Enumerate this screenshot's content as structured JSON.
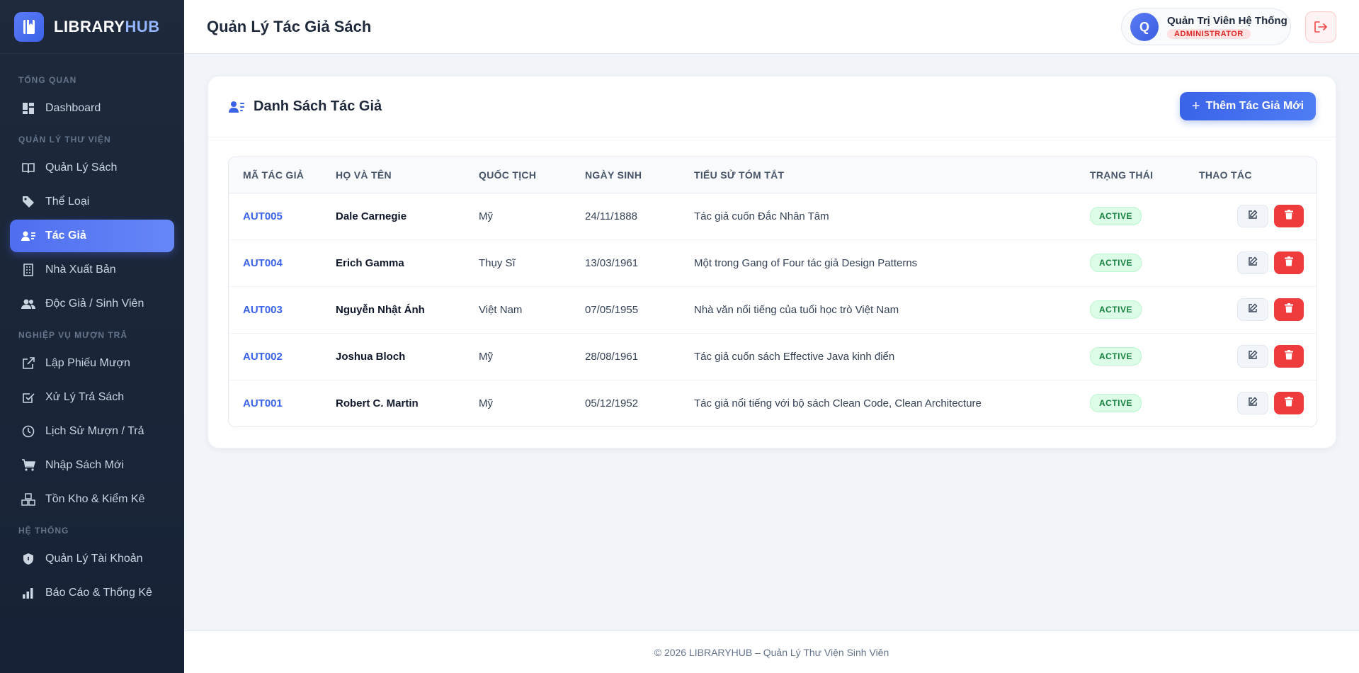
{
  "brand": {
    "prefix": "LIBRARY",
    "suffix": "HUB"
  },
  "sidebar": {
    "sections": [
      {
        "title": "TỔNG QUAN",
        "items": [
          {
            "label": "Dashboard",
            "icon": "dashboard-icon"
          }
        ]
      },
      {
        "title": "QUẢN LÝ THƯ VIỆN",
        "items": [
          {
            "label": "Quản Lý Sách",
            "icon": "book-icon"
          },
          {
            "label": "Thể Loại",
            "icon": "tag-icon"
          },
          {
            "label": "Tác Giả",
            "icon": "author-icon",
            "active": true
          },
          {
            "label": "Nhà Xuất Bản",
            "icon": "building-icon"
          },
          {
            "label": "Độc Giả / Sinh Viên",
            "icon": "users-icon"
          }
        ]
      },
      {
        "title": "NGHIỆP VỤ MƯỢN TRẢ",
        "items": [
          {
            "label": "Lập Phiếu Mượn",
            "icon": "external-link-icon"
          },
          {
            "label": "Xử Lý Trả Sách",
            "icon": "check-square-icon"
          },
          {
            "label": "Lịch Sử Mượn / Trả",
            "icon": "clock-icon"
          },
          {
            "label": "Nhập Sách Mới",
            "icon": "cart-icon"
          },
          {
            "label": "Tồn Kho & Kiểm Kê",
            "icon": "boxes-icon"
          }
        ]
      },
      {
        "title": "HỆ THỐNG",
        "items": [
          {
            "label": "Quản Lý Tài Khoản",
            "icon": "shield-icon"
          },
          {
            "label": "Báo Cáo & Thống Kê",
            "icon": "bar-chart-icon"
          }
        ]
      }
    ]
  },
  "header": {
    "title": "Quản Lý Tác Giả Sách",
    "user": {
      "initial": "Q",
      "name": "Quản Trị Viên Hệ Thống",
      "role": "ADMINISTRATOR"
    }
  },
  "card": {
    "title": "Danh Sách Tác Giả",
    "add_label": "Thêm Tác Giả Mới"
  },
  "table": {
    "columns": [
      "MÃ TÁC GIẢ",
      "HỌ VÀ TÊN",
      "QUỐC TỊCH",
      "NGÀY SINH",
      "TIỂU SỬ TÓM TẮT",
      "TRẠNG THÁI",
      "THAO TÁC"
    ],
    "rows": [
      {
        "code": "AUT005",
        "name": "Dale Carnegie",
        "nationality": "Mỹ",
        "dob": "24/11/1888",
        "bio": "Tác giả cuốn Đắc Nhân Tâm",
        "status": "ACTIVE"
      },
      {
        "code": "AUT004",
        "name": "Erich Gamma",
        "nationality": "Thụy Sĩ",
        "dob": "13/03/1961",
        "bio": "Một trong Gang of Four tác giả Design Patterns",
        "status": "ACTIVE"
      },
      {
        "code": "AUT003",
        "name": "Nguyễn Nhật Ánh",
        "nationality": "Việt Nam",
        "dob": "07/05/1955",
        "bio": "Nhà văn nổi tiếng của tuổi học trò Việt Nam",
        "status": "ACTIVE"
      },
      {
        "code": "AUT002",
        "name": "Joshua Bloch",
        "nationality": "Mỹ",
        "dob": "28/08/1961",
        "bio": "Tác giả cuốn sách Effective Java kinh điển",
        "status": "ACTIVE"
      },
      {
        "code": "AUT001",
        "name": "Robert C. Martin",
        "nationality": "Mỹ",
        "dob": "05/12/1952",
        "bio": "Tác giả nổi tiếng với bộ sách Clean Code, Clean Architecture",
        "status": "ACTIVE"
      }
    ]
  },
  "footer": {
    "text": "© 2026 LIBRARYHUB – Quản Lý Thư Viện Sinh Viên"
  },
  "colors": {
    "accent": "#3b63e8",
    "sidebar_bg": "#1e293b",
    "danger": "#ef3b3b",
    "success": "#15803d"
  }
}
